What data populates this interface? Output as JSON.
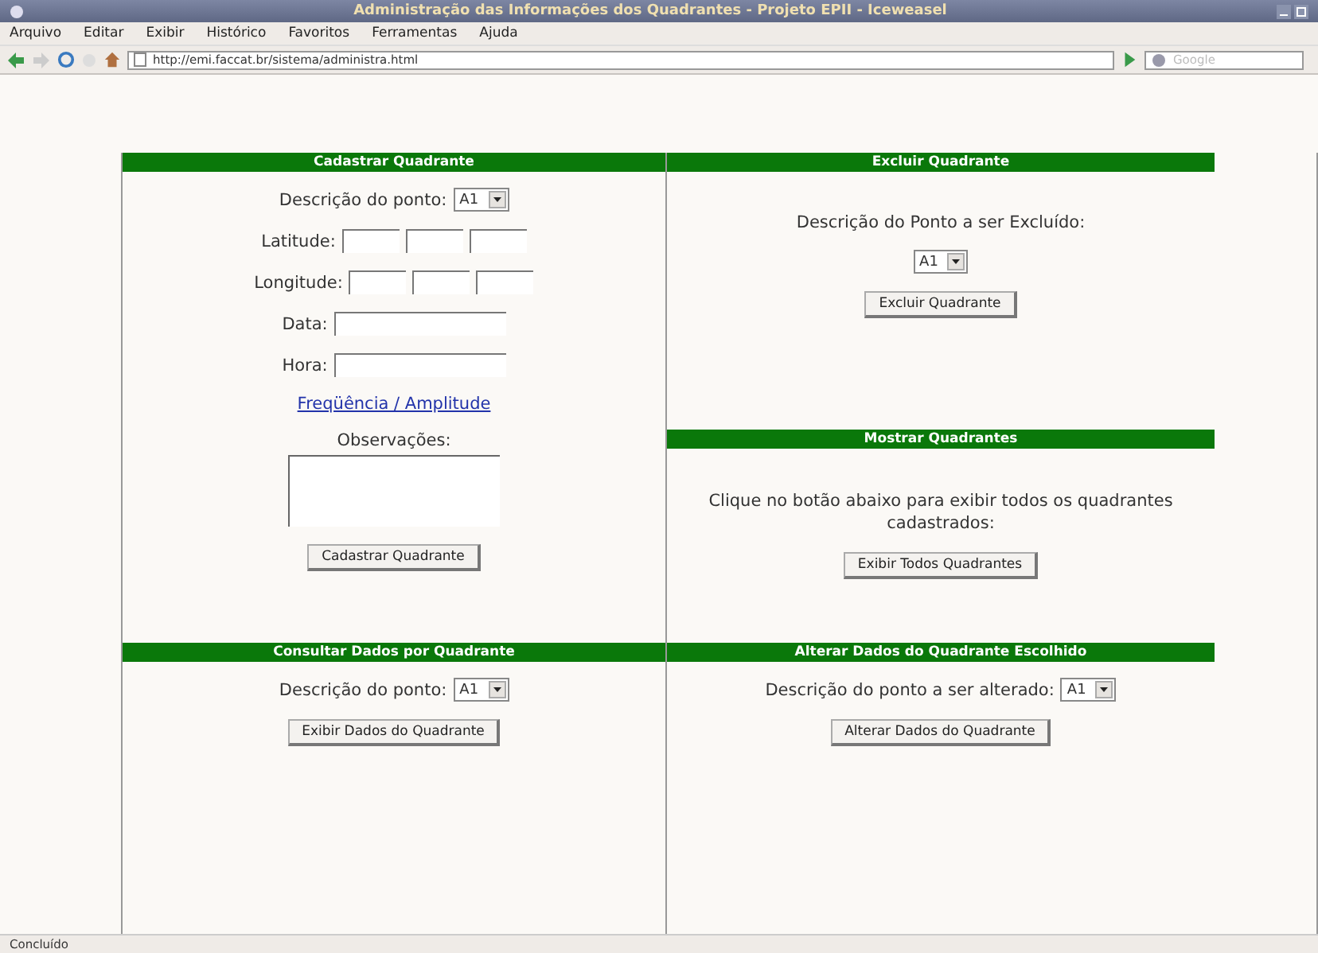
{
  "window": {
    "title": "Administração das Informações dos Quadrantes - Projeto EPII - Iceweasel"
  },
  "menu": [
    "Arquivo",
    "Editar",
    "Exibir",
    "Histórico",
    "Favoritos",
    "Ferramentas",
    "Ajuda"
  ],
  "address_bar": {
    "url": "http://emi.faccat.br/sistema/administra.html"
  },
  "search": {
    "placeholder": "Google"
  },
  "sections": {
    "cadastrar": {
      "title": "Cadastrar Quadrante",
      "point_label": "Descrição do ponto:",
      "point_value": "A1",
      "latitude_label": "Latitude:",
      "longitude_label": "Longitude:",
      "date_label": "Data:",
      "time_label": "Hora:",
      "link": "Freqüência / Amplitude",
      "notes_label": "Observações:",
      "button": "Cadastrar Quadrante"
    },
    "excluir": {
      "title": "Excluir Quadrante",
      "prompt": "Descrição do Ponto a ser Excluído:",
      "point_value": "A1",
      "button": "Excluir Quadrante"
    },
    "mostrar": {
      "title": "Mostrar Quadrantes",
      "message": "Clique no botão abaixo para exibir todos os quadrantes cadastrados:",
      "button": "Exibir Todos Quadrantes"
    },
    "consultar": {
      "title": "Consultar Dados por Quadrante",
      "point_label": "Descrição do ponto:",
      "point_value": "A1",
      "button": "Exibir Dados do Quadrante"
    },
    "alterar": {
      "title": "Alterar Dados do Quadrante Escolhido",
      "point_label": "Descrição do ponto a ser alterado:",
      "point_value": "A1",
      "button": "Alterar Dados do Quadrante"
    }
  },
  "status_bar": "Concluído"
}
